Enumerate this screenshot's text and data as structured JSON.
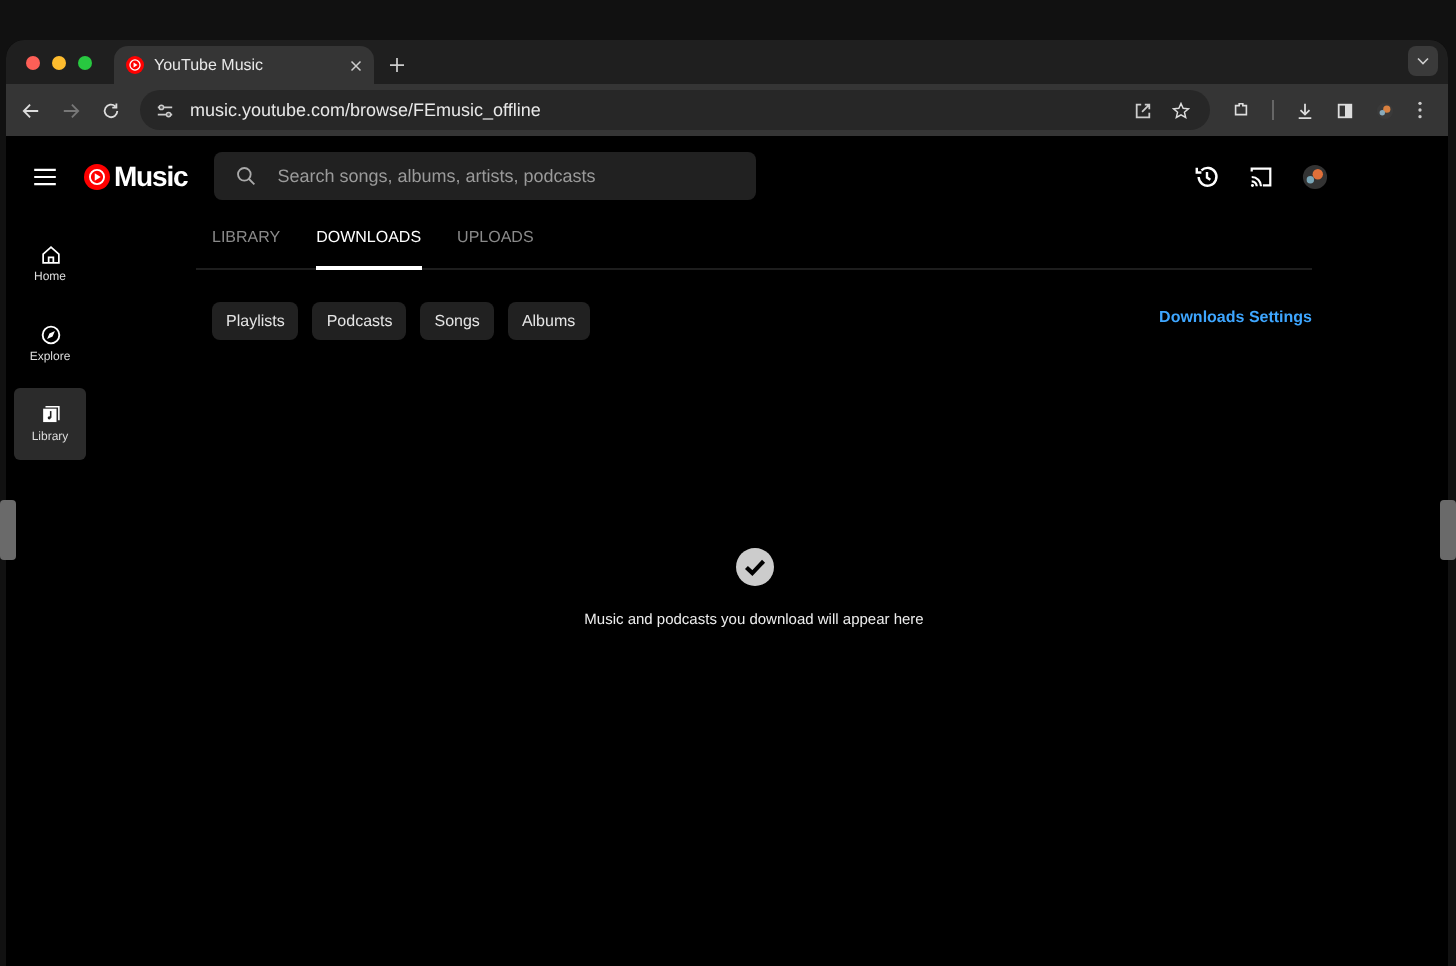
{
  "browser": {
    "tab_title": "YouTube Music",
    "url": "music.youtube.com/browse/FEmusic_offline"
  },
  "app": {
    "logo": "Music",
    "search": {
      "placeholder": "Search songs, albums, artists, podcasts"
    }
  },
  "sidebar": {
    "items": [
      {
        "label": "Home",
        "selected": false
      },
      {
        "label": "Explore",
        "selected": false
      },
      {
        "label": "Library",
        "selected": true
      }
    ]
  },
  "tabs": [
    {
      "label": "LIBRARY",
      "selected": false
    },
    {
      "label": "DOWNLOADS",
      "selected": true
    },
    {
      "label": "UPLOADS",
      "selected": false
    }
  ],
  "chips": [
    "Playlists",
    "Podcasts",
    "Songs",
    "Albums"
  ],
  "settings_link": "Downloads Settings",
  "empty_message": "Music and podcasts you download will appear here"
}
